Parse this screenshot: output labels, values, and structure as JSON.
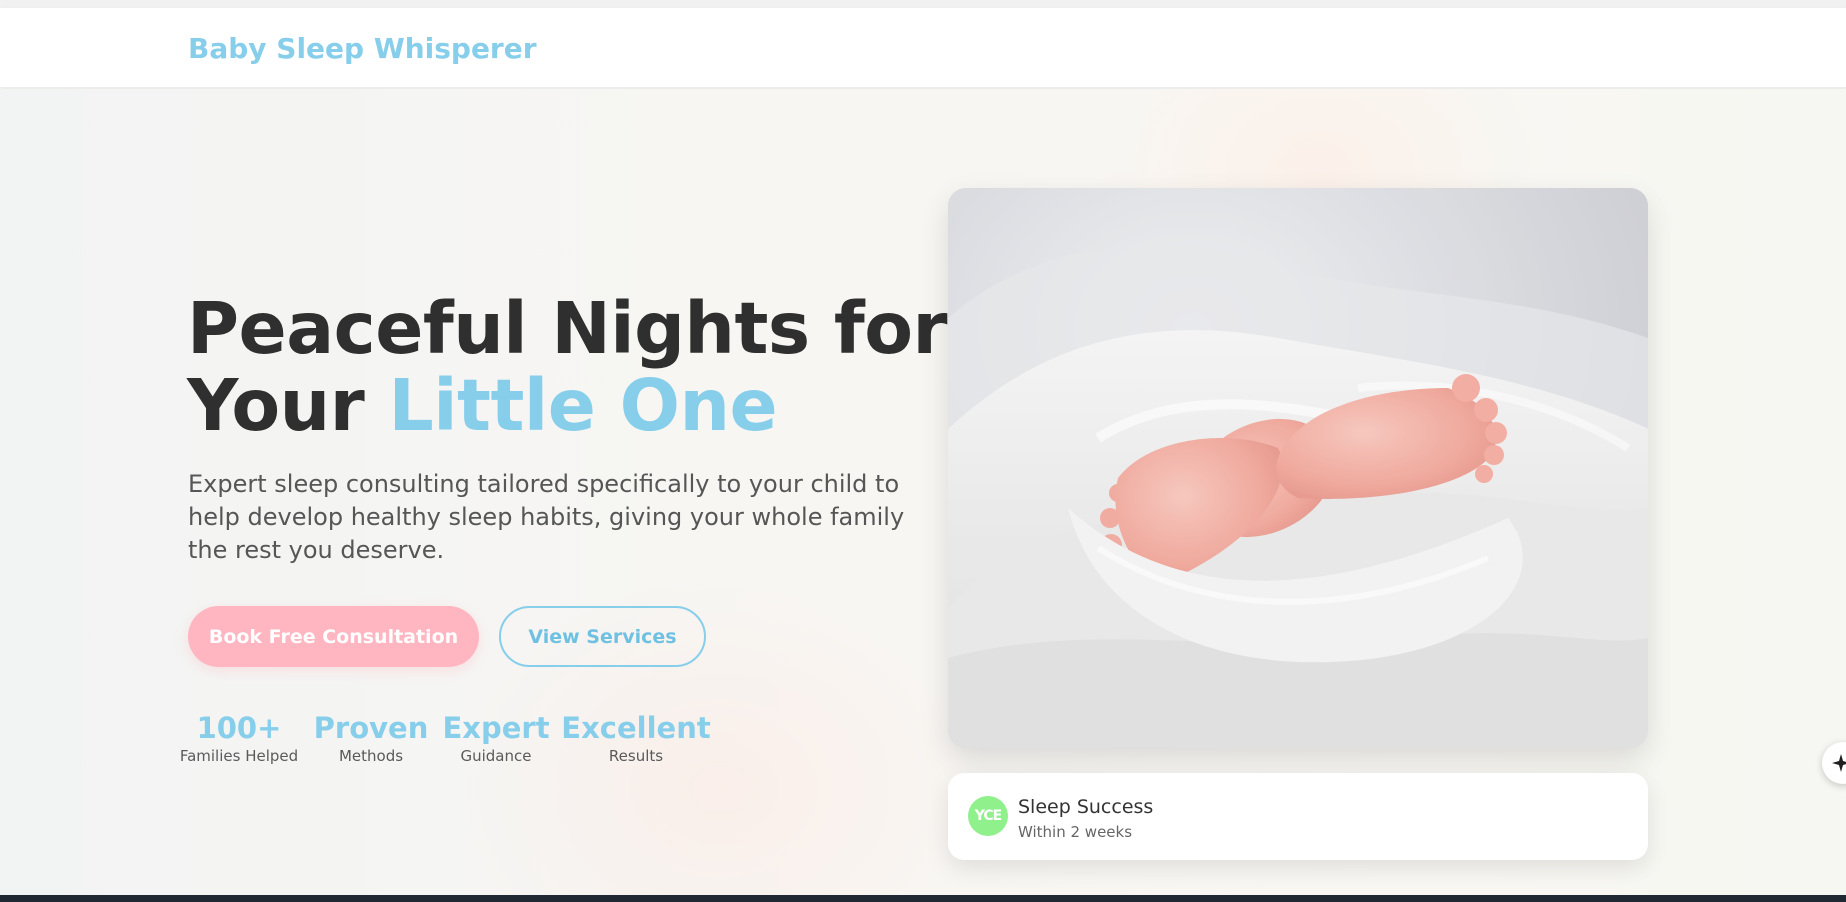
{
  "header": {
    "brand": "Baby Sleep Whisperer"
  },
  "hero": {
    "headline_line1": "Peaceful Nights for",
    "headline_line2_prefix": "Your ",
    "headline_line2_accent": "Little One",
    "subtext": "Expert sleep consulting tailored specifically to your child to help develop healthy sleep habits, giving your whole family the rest you deserve.",
    "primary_button": "Book Free Consultation",
    "secondary_button": "View Services",
    "stats": [
      {
        "value": "100+",
        "label": "Families Helped"
      },
      {
        "value": "Proven",
        "label": "Methods"
      },
      {
        "value": "Expert",
        "label": "Guidance"
      },
      {
        "value": "Excellent",
        "label": "Results"
      }
    ]
  },
  "card": {
    "avatar_text": "YCE",
    "title": "Sleep Success",
    "subtitle": "Within 2 weeks"
  },
  "icons": {
    "floating_action": "sparkle-icon",
    "hero_image": "baby-feet-photo"
  },
  "colors": {
    "accent_blue": "#87ceeb",
    "accent_pink": "#ffb6c1",
    "heading_dark": "#2f2f2f",
    "avatar_green": "#8ff08c"
  }
}
